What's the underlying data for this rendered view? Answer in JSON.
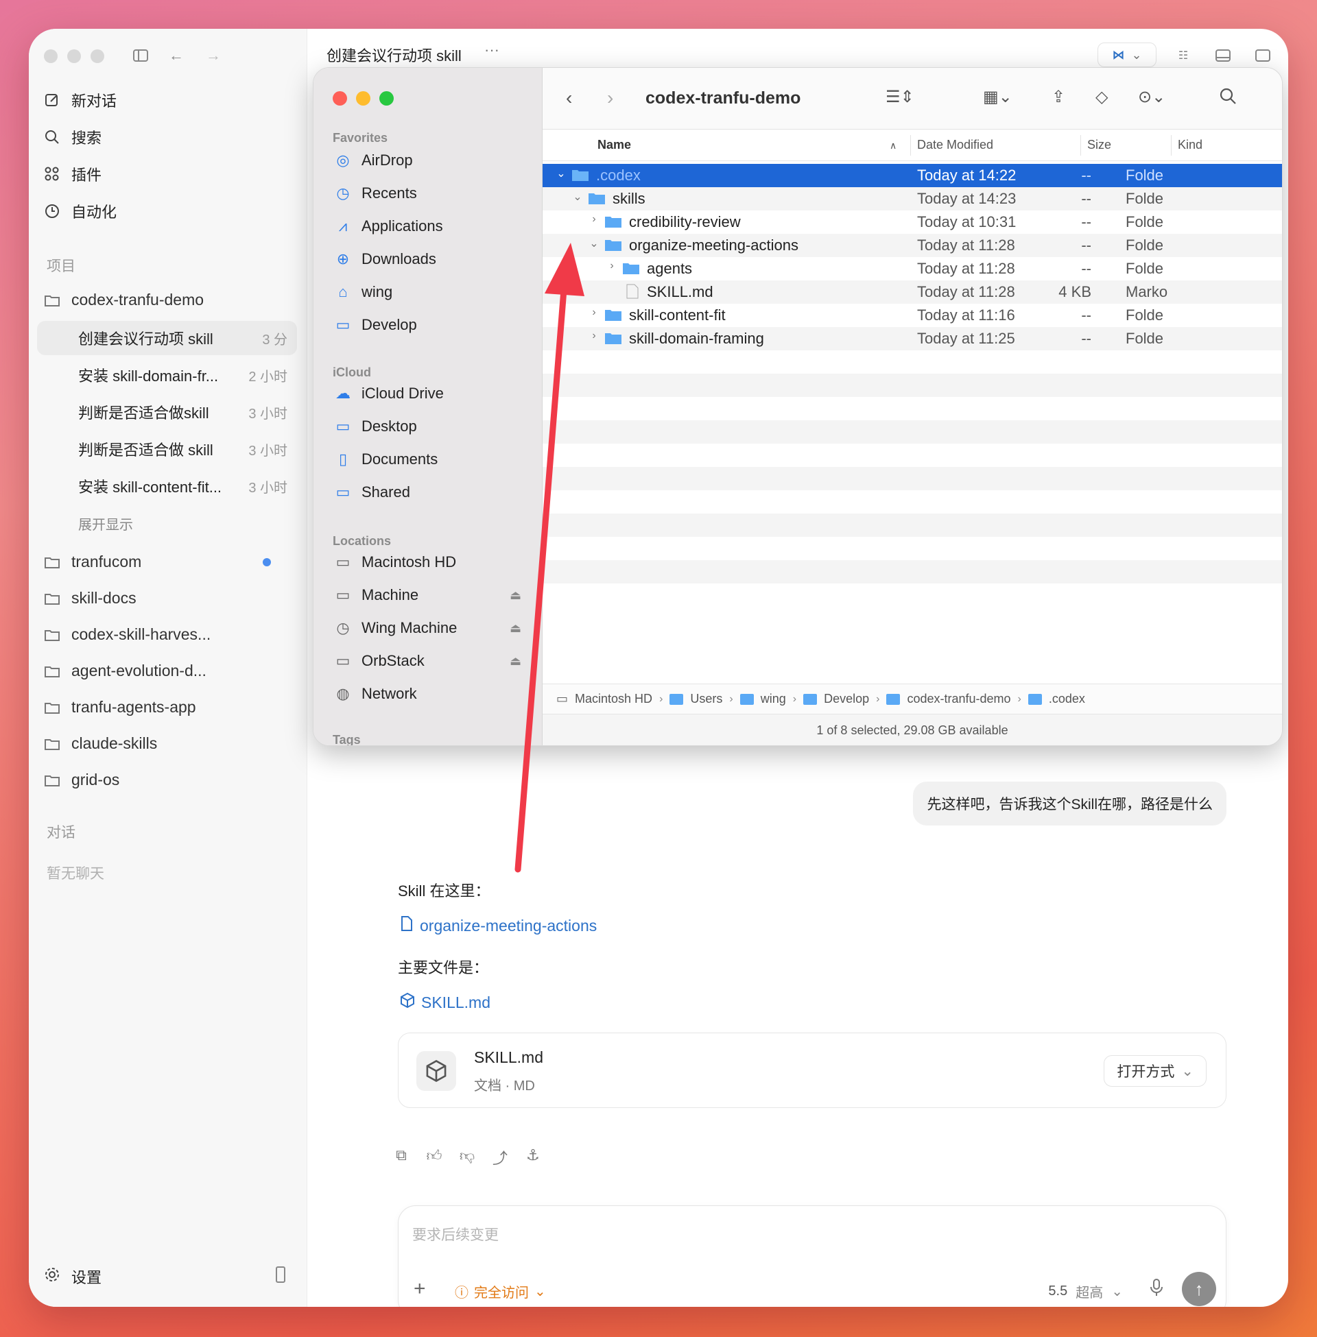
{
  "app": {
    "sidebar": {
      "nav": [
        {
          "label": "新对话",
          "icon": "edit-icon"
        },
        {
          "label": "搜索",
          "icon": "search-icon"
        },
        {
          "label": "插件",
          "icon": "grid-icon"
        },
        {
          "label": "自动化",
          "icon": "clock-icon"
        }
      ],
      "projects_label": "项目",
      "active_project": "codex-tranfu-demo",
      "conversations": [
        {
          "title": "创建会议行动项 skill",
          "time": "3 分"
        },
        {
          "title": "安装 skill-domain-fr...",
          "time": "2 小时"
        },
        {
          "title": "判断是否适合做skill",
          "time": "3 小时"
        },
        {
          "title": "判断是否适合做 skill",
          "time": "3 小时"
        },
        {
          "title": "安装 skill-content-fit...",
          "time": "3 小时"
        }
      ],
      "expand_label": "展开显示",
      "projects": [
        "tranfucom",
        "skill-docs",
        "codex-skill-harves...",
        "agent-evolution-d...",
        "tranfu-agents-app",
        "claude-skills",
        "grid-os"
      ],
      "chats_label": "对话",
      "no_chats": "暂无聊天",
      "settings": "设置"
    },
    "header": {
      "title": "创建会议行动项 skill",
      "more": "···"
    }
  },
  "finder": {
    "title": "codex-tranfu-demo",
    "sidebar": {
      "favorites_label": "Favorites",
      "favorites": [
        "AirDrop",
        "Recents",
        "Applications",
        "Downloads",
        "wing",
        "Develop"
      ],
      "icloud_label": "iCloud",
      "icloud": [
        "iCloud Drive",
        "Desktop",
        "Documents",
        "Shared"
      ],
      "locations_label": "Locations",
      "locations": [
        "Macintosh HD",
        "Machine",
        "Wing Machine",
        "OrbStack",
        "Network"
      ],
      "tags_label": "Tags"
    },
    "columns": {
      "name": "Name",
      "date": "Date Modified",
      "size": "Size",
      "kind": "Kind"
    },
    "rows": [
      {
        "name": ".codex",
        "date": "Today at 14:22",
        "size": "--",
        "kind": "Folde"
      },
      {
        "name": "skills",
        "date": "Today at 14:23",
        "size": "--",
        "kind": "Folde"
      },
      {
        "name": "credibility-review",
        "date": "Today at 10:31",
        "size": "--",
        "kind": "Folde"
      },
      {
        "name": "organize-meeting-actions",
        "date": "Today at 11:28",
        "size": "--",
        "kind": "Folde"
      },
      {
        "name": "agents",
        "date": "Today at 11:28",
        "size": "--",
        "kind": "Folde"
      },
      {
        "name": "SKILL.md",
        "date": "Today at 11:28",
        "size": "4 KB",
        "kind": "Marko"
      },
      {
        "name": "skill-content-fit",
        "date": "Today at 11:16",
        "size": "--",
        "kind": "Folde"
      },
      {
        "name": "skill-domain-framing",
        "date": "Today at 11:25",
        "size": "--",
        "kind": "Folde"
      }
    ],
    "path": [
      "Macintosh HD",
      "Users",
      "wing",
      "Develop",
      "codex-tranfu-demo",
      ".codex"
    ],
    "status": "1 of 8 selected, 29.08 GB available"
  },
  "chat": {
    "user_message": "先这样吧，告诉我这个Skill在哪，路径是什么",
    "reply_intro": "Skill 在这里：",
    "folder_link": "organize-meeting-actions",
    "main_file_label": "主要文件是：",
    "file_link": "SKILL.md",
    "card": {
      "name": "SKILL.md",
      "meta": "文档 · MD",
      "open_with": "打开方式"
    },
    "composer": {
      "placeholder": "要求后续变更",
      "access": "完全访问",
      "model": "5.5",
      "level": "超高"
    }
  },
  "colors": {
    "selection": "#1e66d6",
    "link": "#2d72c8",
    "warning": "#e27a16",
    "arrow": "#f03a48"
  }
}
